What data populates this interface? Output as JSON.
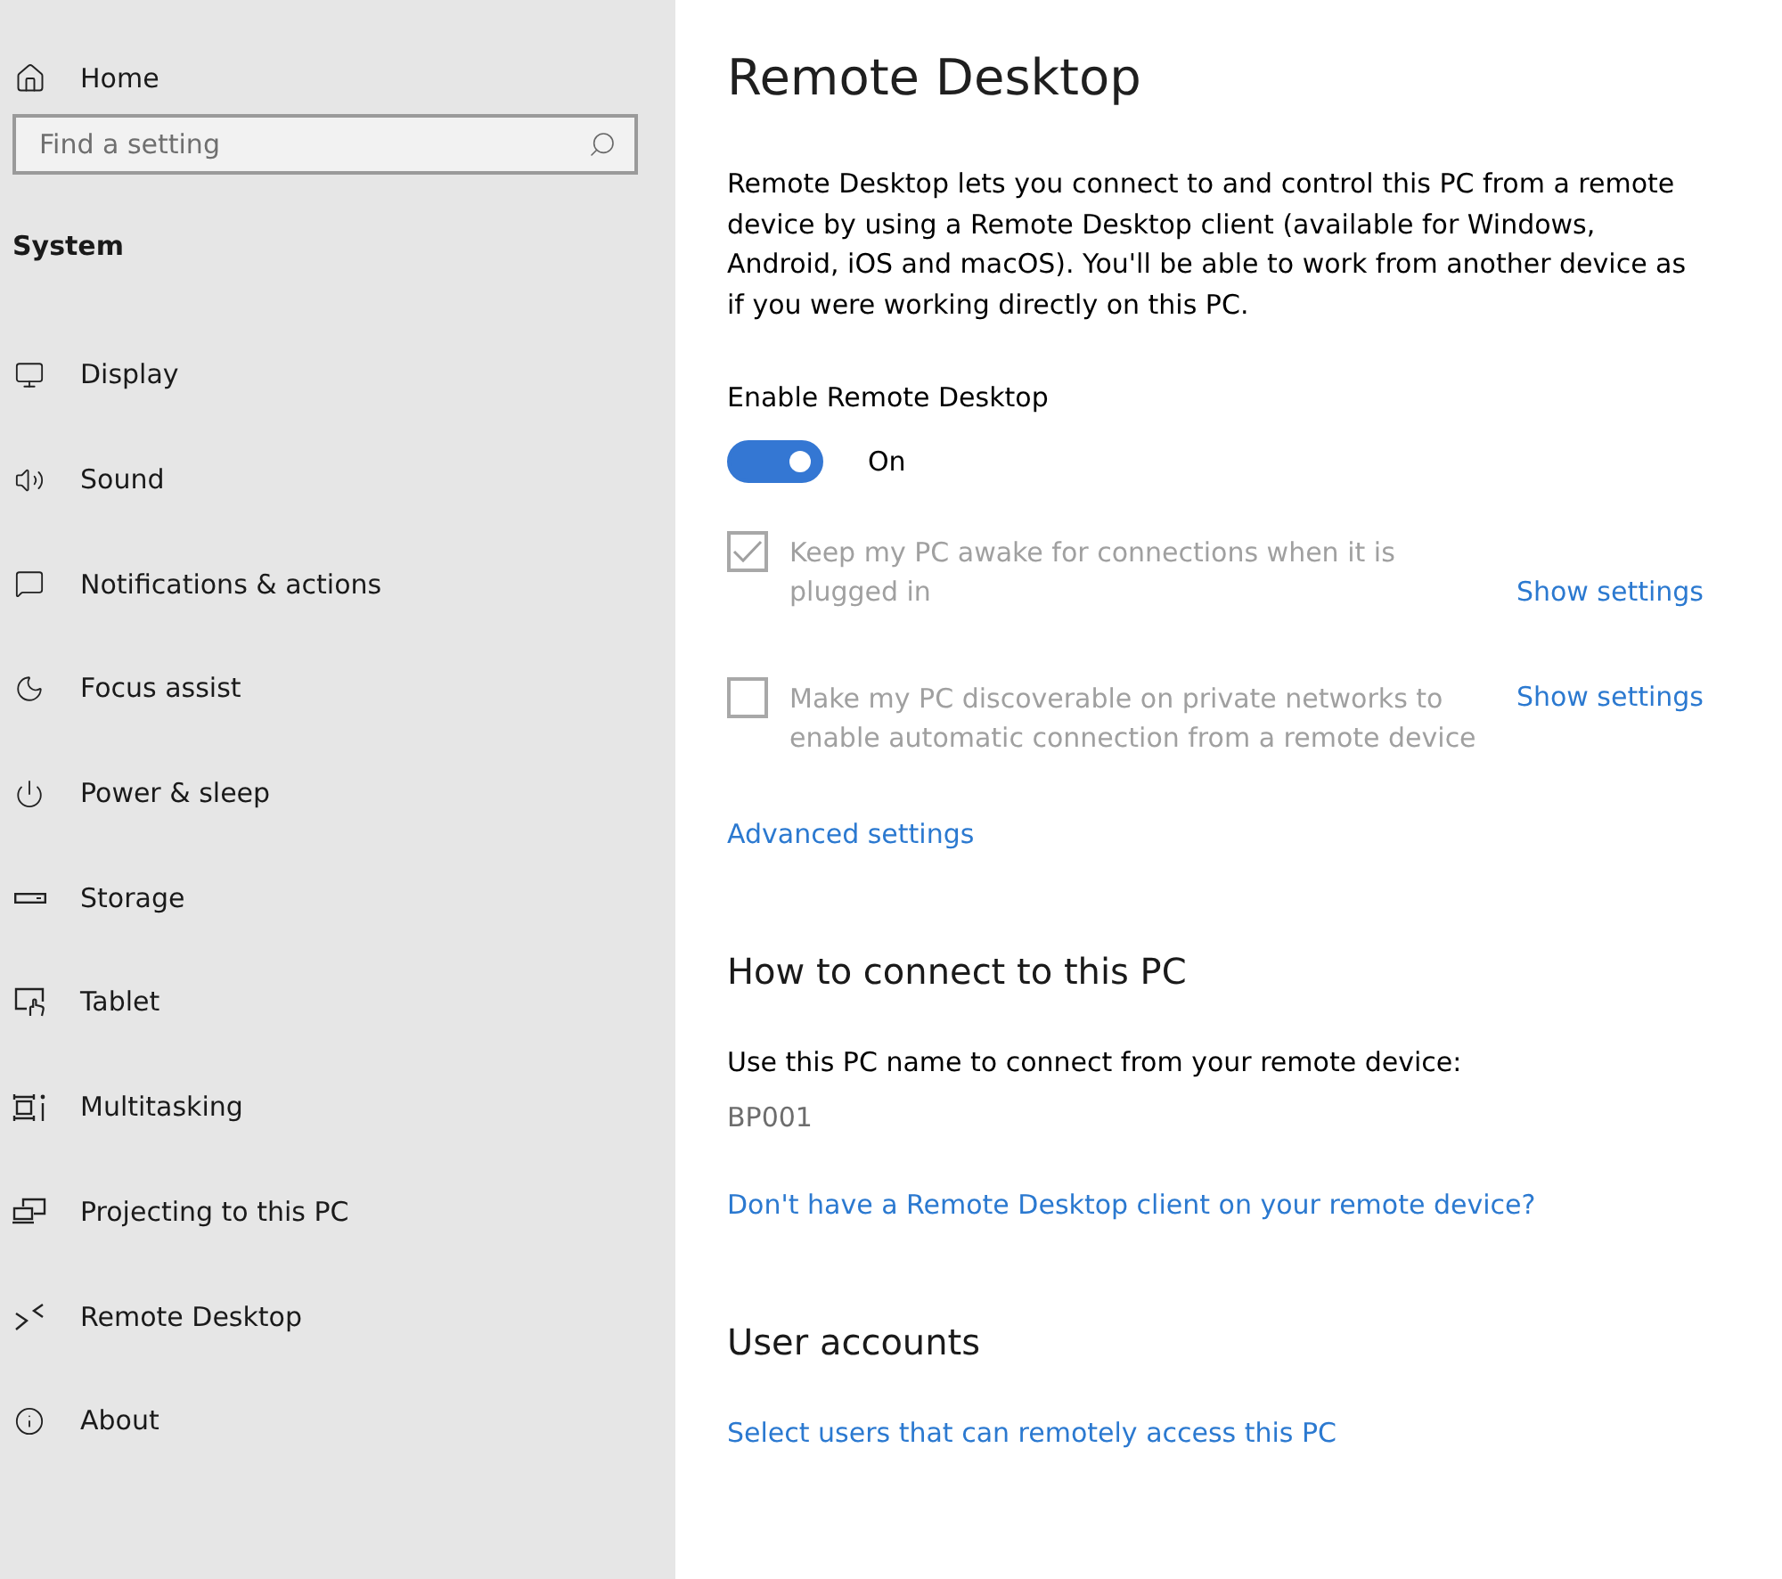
{
  "sidebar": {
    "home": {
      "label": "Home"
    },
    "search": {
      "placeholder": "Find a setting"
    },
    "section": "System",
    "items": [
      {
        "label": "Display"
      },
      {
        "label": "Sound"
      },
      {
        "label": "Notifications & actions"
      },
      {
        "label": "Focus assist"
      },
      {
        "label": "Power & sleep"
      },
      {
        "label": "Storage"
      },
      {
        "label": "Tablet"
      },
      {
        "label": "Multitasking"
      },
      {
        "label": "Projecting to this PC"
      },
      {
        "label": "Remote Desktop"
      },
      {
        "label": "About"
      }
    ]
  },
  "page": {
    "title": "Remote Desktop",
    "description": "Remote Desktop lets you connect to and control this PC from a remote device by using a Remote Desktop client (available for Windows, Android, iOS and macOS). You'll be able to work from another device as if you were working directly on this PC.",
    "enable": {
      "label": "Enable Remote Desktop",
      "on": true,
      "state_label": "On"
    },
    "options": [
      {
        "label": "Keep my PC awake for connections when it is plugged in",
        "checked": true,
        "disabled": true,
        "link": "Show settings"
      },
      {
        "label": "Make my PC discoverable on private networks to enable automatic connection from a remote device",
        "checked": false,
        "disabled": true,
        "link": "Show settings"
      }
    ],
    "advanced_link": "Advanced settings"
  },
  "connect": {
    "heading": "How to connect to this PC",
    "instruction": "Use this PC name to connect from your remote device:",
    "pc_name": "BP001",
    "client_link": "Don't have a Remote Desktop client on your remote device?"
  },
  "user_accounts": {
    "heading": "User accounts",
    "link": "Select users that can remotely access this PC"
  }
}
